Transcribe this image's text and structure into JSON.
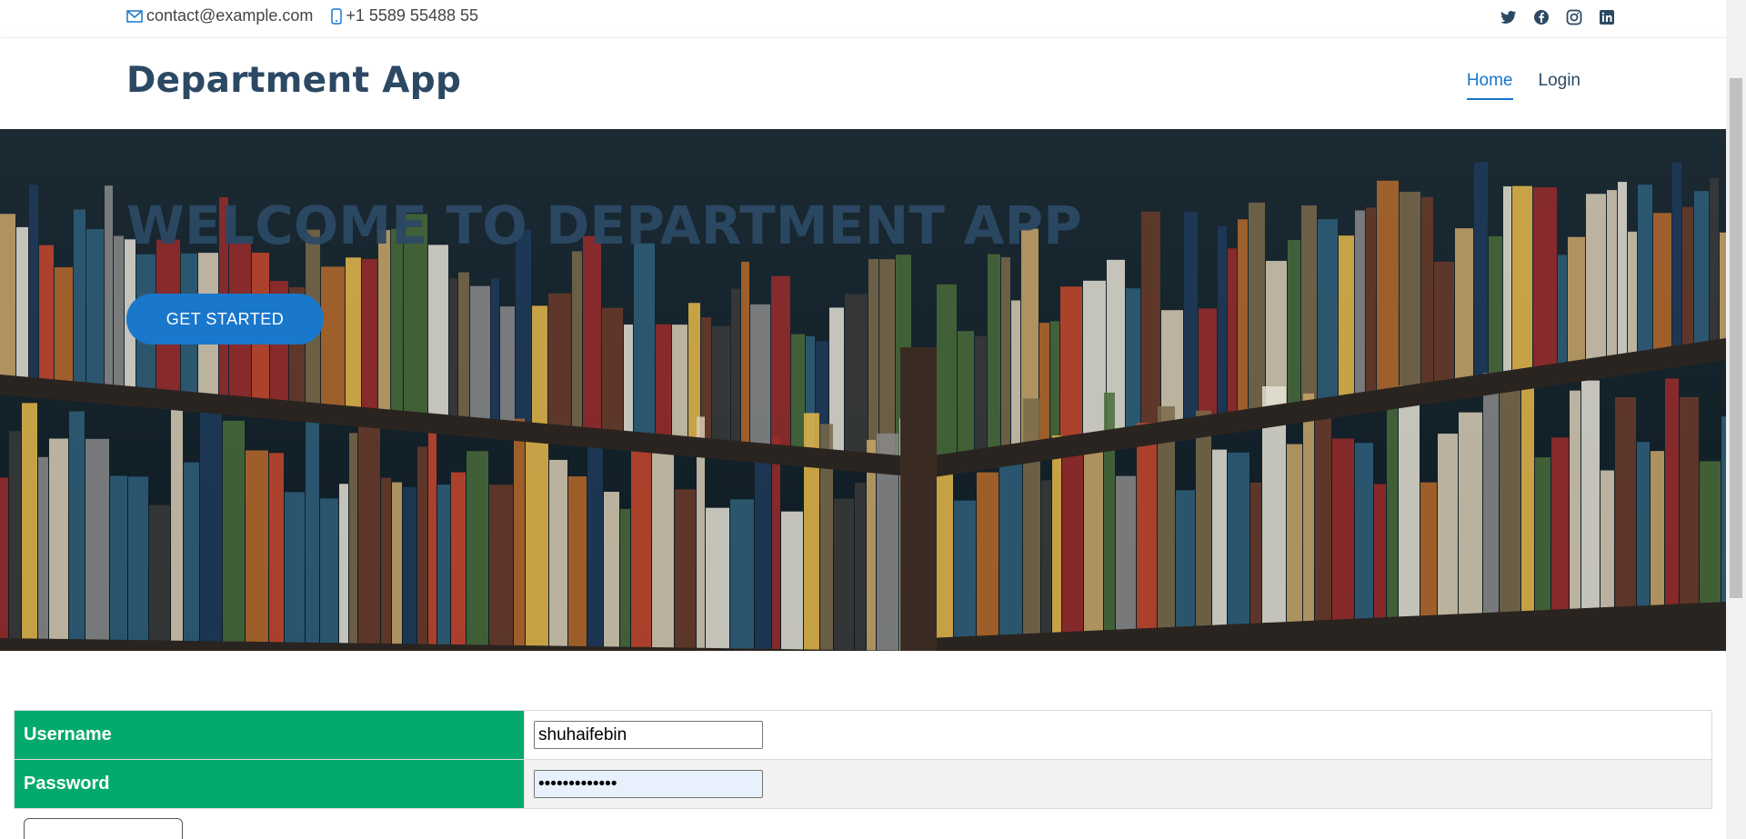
{
  "topbar": {
    "email": "contact@example.com",
    "phone": "+1 5589 55488 55",
    "social_icons": [
      "twitter-icon",
      "facebook-icon",
      "instagram-icon",
      "linkedin-icon"
    ]
  },
  "header": {
    "logo": "Department App",
    "nav": [
      {
        "label": "Home",
        "active": true
      },
      {
        "label": "Login",
        "active": false
      }
    ]
  },
  "hero": {
    "title": "WELCOME TO DEPARTMENT APP",
    "cta": "GET STARTED"
  },
  "form": {
    "username_label": "Username",
    "username_value": "shuhaifebin",
    "password_label": "Password",
    "password_value": "•••••••••••••"
  },
  "colors": {
    "brand": "#2c4964",
    "accent": "#1977cc",
    "form_label_bg": "#04aa6d"
  }
}
